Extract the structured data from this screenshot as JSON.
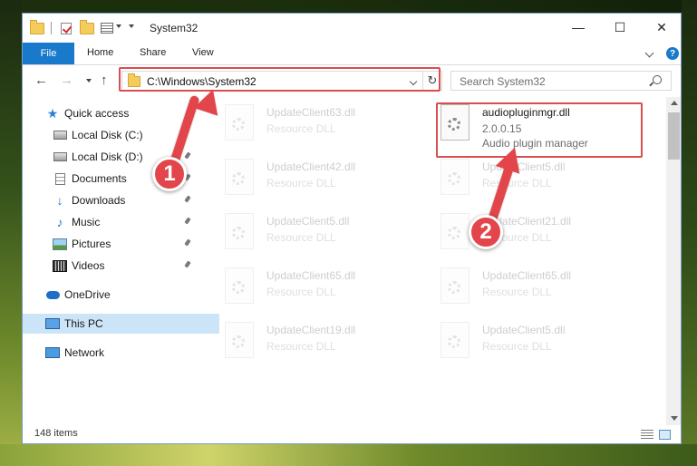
{
  "window": {
    "title": "System32"
  },
  "ribbon": {
    "tabs": [
      "File",
      "Home",
      "Share",
      "View"
    ]
  },
  "address": {
    "path": "C:\\Windows\\System32"
  },
  "search": {
    "placeholder": "Search System32"
  },
  "nav": {
    "items": [
      {
        "label": "Quick access",
        "icon": "star-icon"
      },
      {
        "label": "Local Disk (C:)",
        "icon": "drive-icon"
      },
      {
        "label": "Local Disk (D:)",
        "icon": "drive-icon"
      },
      {
        "label": "Documents",
        "icon": "documents-icon"
      },
      {
        "label": "Downloads",
        "icon": "download-icon"
      },
      {
        "label": "Music",
        "icon": "music-icon"
      },
      {
        "label": "Pictures",
        "icon": "pictures-icon"
      },
      {
        "label": "Videos",
        "icon": "videos-icon"
      },
      {
        "label": "OneDrive",
        "icon": "onedrive-icon"
      },
      {
        "label": "This PC",
        "icon": "computer-icon"
      },
      {
        "label": "Network",
        "icon": "network-icon"
      }
    ]
  },
  "files": [
    {
      "name": "UpdateClient63.dll",
      "type": "Resource DLL"
    },
    {
      "name": "audiopluginmgr.dll",
      "version": "2.0.0.15",
      "description": "Audio plugin manager"
    },
    {
      "name": "UpdateClient42.dll",
      "type": "Resource DLL"
    },
    {
      "name": "UpdateClient5.dll",
      "type": "Resource DLL"
    },
    {
      "name": "UpdateClient5.dll",
      "type": "Resource DLL"
    },
    {
      "name": "UpdateClient21.dll",
      "type": "Resource DLL"
    },
    {
      "name": "UpdateClient65.dll",
      "type": "Resource DLL"
    },
    {
      "name": "UpdateClient65.dll",
      "type": "Resource DLL"
    },
    {
      "name": "UpdateClient19.dll",
      "type": "Resource DLL"
    },
    {
      "name": "UpdateClient5.dll",
      "type": "Resource DLL"
    }
  ],
  "status": {
    "items": "148 items"
  },
  "annotations": {
    "badge1": "1",
    "badge2": "2"
  },
  "colors": {
    "accent": "#1979ca",
    "highlight": "#d94e50",
    "selected": "#cce4f7"
  }
}
